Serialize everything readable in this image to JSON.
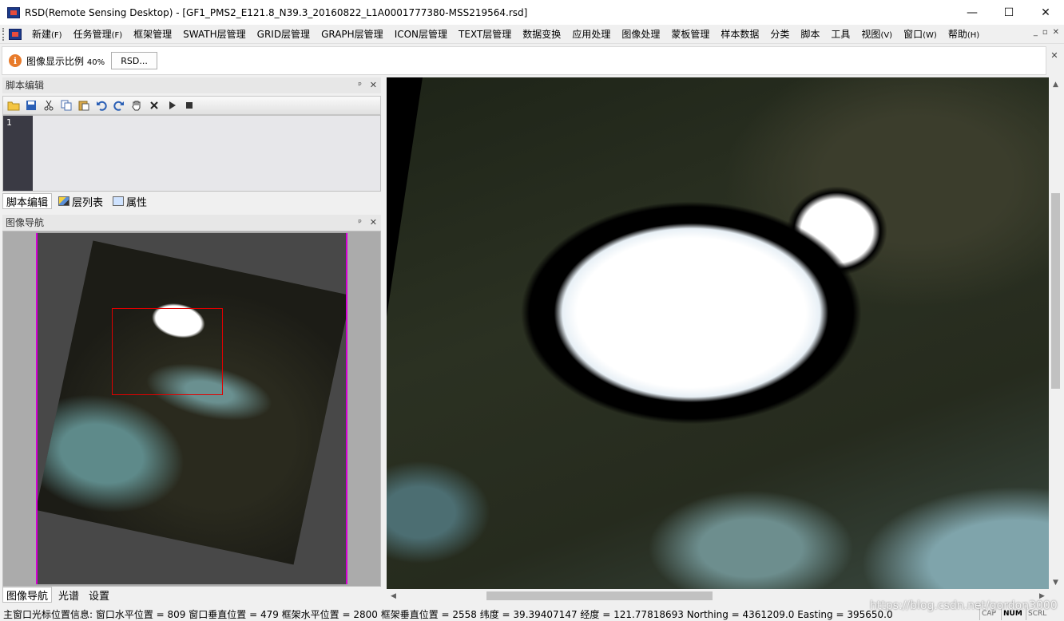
{
  "window": {
    "title": "RSD(Remote Sensing Desktop) - [GF1_PMS2_E121.8_N39.3_20160822_L1A0001777380-MSS219564.rsd]",
    "minimize": "—",
    "maximize": "☐",
    "close": "✕"
  },
  "menubar": {
    "items": [
      {
        "label": "新建",
        "accel": "(F)"
      },
      {
        "label": "任务管理",
        "accel": "(F)"
      },
      {
        "label": "框架管理",
        "accel": ""
      },
      {
        "label": "SWATH层管理",
        "accel": ""
      },
      {
        "label": "GRID层管理",
        "accel": ""
      },
      {
        "label": "GRAPH层管理",
        "accel": ""
      },
      {
        "label": "ICON层管理",
        "accel": ""
      },
      {
        "label": "TEXT层管理",
        "accel": ""
      },
      {
        "label": "数据变换",
        "accel": ""
      },
      {
        "label": "应用处理",
        "accel": ""
      },
      {
        "label": "图像处理",
        "accel": ""
      },
      {
        "label": "蒙板管理",
        "accel": ""
      },
      {
        "label": "样本数据",
        "accel": ""
      },
      {
        "label": "分类",
        "accel": ""
      },
      {
        "label": "脚本",
        "accel": ""
      },
      {
        "label": "工具",
        "accel": ""
      },
      {
        "label": "视图",
        "accel": "(V)"
      },
      {
        "label": "窗口",
        "accel": "(W)"
      },
      {
        "label": "帮助",
        "accel": "(H)"
      }
    ],
    "mdi_min": "_",
    "mdi_restore": "▫",
    "mdi_close": "✕"
  },
  "infobar": {
    "icon": "i",
    "text": "图像显示比例",
    "scale": "40%",
    "button": "RSD...",
    "close": "✕"
  },
  "script_panel": {
    "title": "脚本编辑",
    "pin": "ᵖ",
    "close": "✕",
    "line_number": "1",
    "toolbar_icons": [
      "open-icon",
      "save-icon",
      "cut-icon",
      "copy-icon",
      "paste-icon",
      "undo-icon",
      "redo-icon",
      "hand-icon",
      "delete-icon",
      "run-icon",
      "stop-icon"
    ]
  },
  "left_tabs_top": [
    "脚本编辑",
    "层列表",
    "属性"
  ],
  "nav_panel": {
    "title": "图像导航",
    "pin": "ᵖ",
    "close": "✕"
  },
  "left_tabs_bottom": [
    "图像导航",
    "光谱",
    "设置"
  ],
  "status": {
    "text": "主窗口光标位置信息:  窗口水平位置 = 809 窗口垂直位置 = 479 框架水平位置 = 2800 框架垂直位置 = 2558 纬度 = 39.39407147 经度 = 121.77818693 Northing = 4361209.0 Easting = 395650.0",
    "cap": "CAP",
    "num": "NUM",
    "scrl": "SCRL",
    "watermark": "https://blog.csdn.net/gordon3000"
  },
  "colors": {
    "nav_border": "#d500d5",
    "nav_rect": "#e00000",
    "info_icon": "#e87b2b"
  }
}
